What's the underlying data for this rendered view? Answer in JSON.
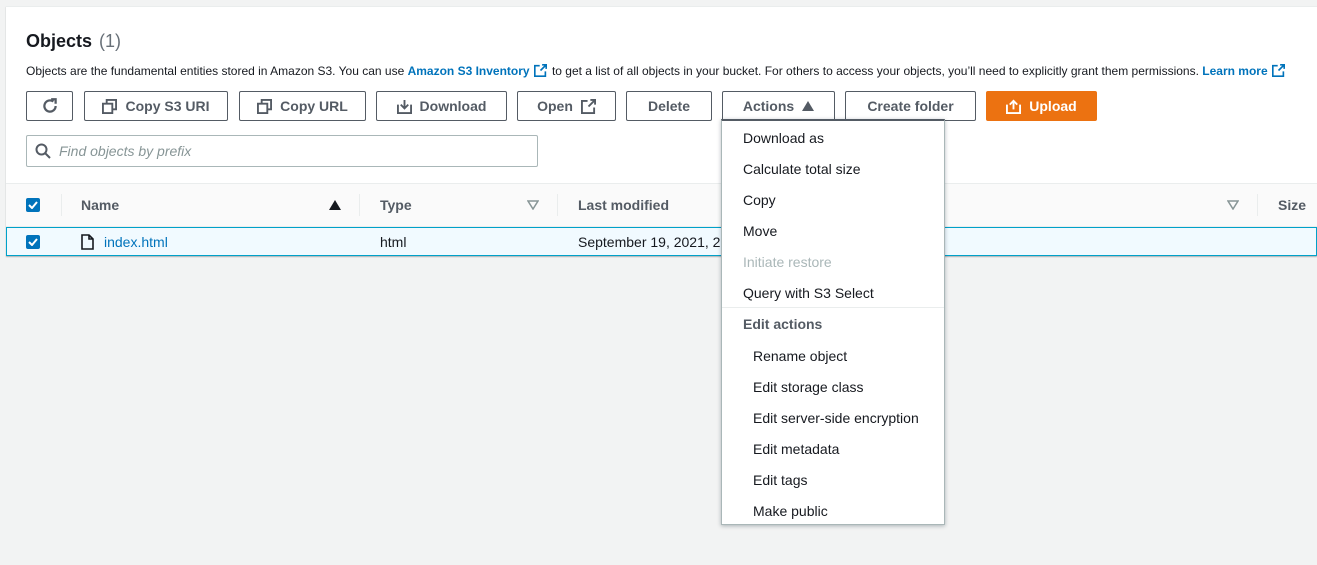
{
  "header": {
    "title": "Objects",
    "count": "(1)",
    "desc_before": "Objects are the fundamental entities stored in Amazon S3. You can use ",
    "inventory_link": "Amazon S3 Inventory",
    "desc_middle": " to get a list of all objects in your bucket. For others to access your objects, you’ll need to explicitly grant them permissions.",
    "learn_more": "Learn more"
  },
  "toolbar": {
    "copy_s3_uri": "Copy S3 URI",
    "copy_url": "Copy URL",
    "download": "Download",
    "open": "Open",
    "delete": "Delete",
    "actions": "Actions",
    "create_folder": "Create folder",
    "upload": "Upload"
  },
  "search": {
    "placeholder": "Find objects by prefix"
  },
  "table": {
    "columns": {
      "name": "Name",
      "type": "Type",
      "last_modified": "Last modified",
      "size": "Size"
    },
    "rows": [
      {
        "name": "index.html",
        "type": "html",
        "last_modified": "September 19, 2021, 2"
      }
    ]
  },
  "actions_menu": {
    "items": [
      "Download as",
      "Calculate total size",
      "Copy",
      "Move",
      "Initiate restore",
      "Query with S3 Select"
    ],
    "group_label": "Edit actions",
    "edit_items": [
      "Rename object",
      "Edit storage class",
      "Edit server-side encryption",
      "Edit metadata",
      "Edit tags",
      "Make public"
    ]
  },
  "colors": {
    "primary": "#ec7211",
    "link": "#0073bb",
    "selected_row": "#f1faff",
    "border": "#545b64"
  },
  "icons": [
    "refresh-icon",
    "copy-icon",
    "download-icon",
    "external-link-icon",
    "caret-up-icon",
    "upload-icon",
    "search-icon",
    "file-icon",
    "sort-ascending-icon",
    "sort-descending-icon",
    "checkbox-checked-icon"
  ]
}
